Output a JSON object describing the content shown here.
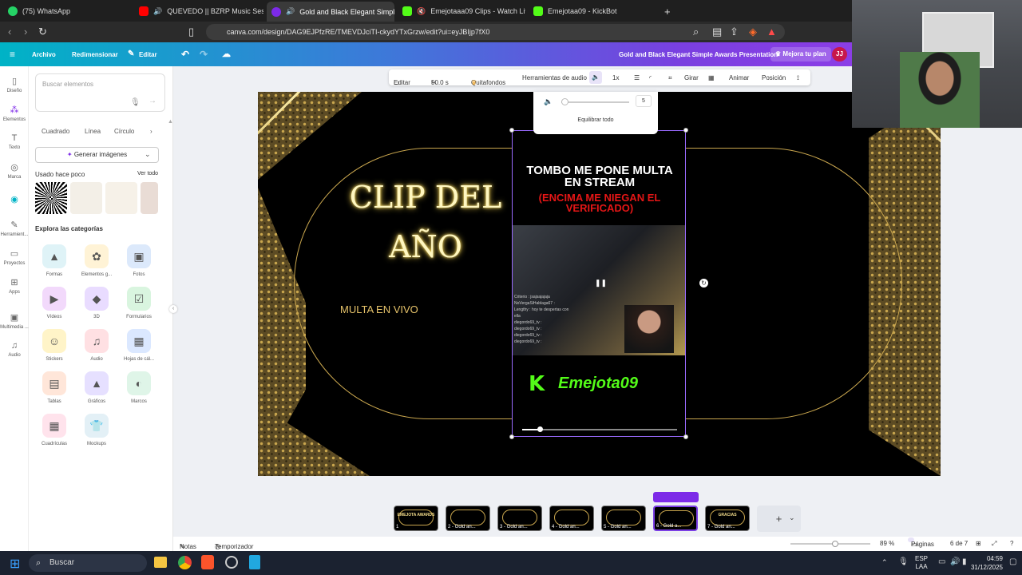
{
  "browser": {
    "tabs": [
      {
        "label": "(75) WhatsApp",
        "color": "#25d366"
      },
      {
        "label": "QUEVEDO || BZRP Music Session",
        "color": "#ff0000"
      },
      {
        "label": "Gold and Black Elegant Simpl",
        "color": "#7d2ae8"
      },
      {
        "label": "Emejotaaa09 Clips - Watch Live o",
        "color": "#53fc18"
      },
      {
        "label": "Emejotaa09 - KickBot",
        "color": "#53fc18"
      }
    ],
    "new_tab": "+",
    "url": "canva.com/design/DAG9EJPfzRE/TMEVDJciTI-ckydYTxGrzw/edit?ui=eyJBIjp7fX0"
  },
  "canva": {
    "menu": [
      "Archivo",
      "Redimensionar",
      "Editar"
    ],
    "doc_title": "Gold and Black Elegant Simple Awards Presentation",
    "upgrade": "Mejora tu plan",
    "avatar": "JJ"
  },
  "rail": [
    "Diseño",
    "Elementos",
    "Texto",
    "Marca",
    "Herramient...",
    "Proyectos",
    "Apps",
    "Multimedia ...",
    "Audio"
  ],
  "panel": {
    "search_placeholder": "Buscar elementos",
    "chips": [
      "Cuadrado",
      "Línea",
      "Círculo"
    ],
    "generate": "Generar imágenes",
    "recent_title": "Usado hace poco",
    "see_all": "Ver todo",
    "categories_title": "Explora las categorías",
    "categories": [
      {
        "label": "Formas",
        "icon": "shapes-icon",
        "bg": "#dff3f7",
        "glyph": "▲"
      },
      {
        "label": "Elementos g...",
        "icon": "sunflower-icon",
        "bg": "#fff3d6",
        "glyph": "✿"
      },
      {
        "label": "Fotos",
        "icon": "photo-icon",
        "bg": "#dce9fb",
        "glyph": "▣"
      },
      {
        "label": "Vídeos",
        "icon": "video-icon",
        "bg": "#f2d9fb",
        "glyph": "▶"
      },
      {
        "label": "3D",
        "icon": "cube-icon",
        "bg": "#e9dcff",
        "glyph": "◆"
      },
      {
        "label": "Formularios",
        "icon": "form-icon",
        "bg": "#d9f5df",
        "glyph": "☑"
      },
      {
        "label": "Stickers",
        "icon": "smiley-icon",
        "bg": "#fff4c8",
        "glyph": "☺"
      },
      {
        "label": "Audio",
        "icon": "music-icon",
        "bg": "#ffe0e3",
        "glyph": "♫"
      },
      {
        "label": "Hojas de cál...",
        "icon": "sheet-icon",
        "bg": "#dbe8ff",
        "glyph": "▦"
      },
      {
        "label": "Tablas",
        "icon": "table-icon",
        "bg": "#ffe6d9",
        "glyph": "▤"
      },
      {
        "label": "Gráficos",
        "icon": "chart-icon",
        "bg": "#e6e0ff",
        "glyph": "▲"
      },
      {
        "label": "Marcos",
        "icon": "frame-icon",
        "bg": "#dff5e8",
        "glyph": "◐"
      },
      {
        "label": "Cuadrículas",
        "icon": "grid-icon",
        "bg": "#ffe3ec",
        "glyph": "▦"
      },
      {
        "label": "Mockups",
        "icon": "shirt-icon",
        "bg": "#e3f0f6",
        "glyph": "👕"
      }
    ]
  },
  "toolbar": {
    "items": [
      "Editar",
      "50.0 s",
      "Quitafondos",
      "Herramientas de audio",
      "1x",
      "Girar",
      "Animar",
      "Posición"
    ]
  },
  "volume": {
    "value": "5",
    "balance": "Equilibrar todo"
  },
  "slide": {
    "title_line1": "CLIP DEL",
    "title_line2": "AÑO",
    "subtitle": "MULTA EN VIVO",
    "video_caption_white": "TOMBO ME PONE MULTA EN STREAM",
    "video_caption_red": "(ENCIMA ME NIEGAN EL VERIFICADO)",
    "channel": "Emejota09",
    "channel_logo": "K",
    "chat": [
      "Criterio : jsajsajajaja",
      "NoVergaSiHablaga67 :",
      "Lengthy : hoy te despertas con",
      "ella",
      "diegordo69_tv :",
      "diegordo69_tv :",
      "diegordo69_tv :",
      "diegordo69_tv :"
    ]
  },
  "pages": {
    "thumbs": [
      {
        "label": "1",
        "text": "EMEJOTA AWARDS"
      },
      {
        "label": "2 - Gold an...",
        "text": ""
      },
      {
        "label": "3 - Gold an...",
        "text": ""
      },
      {
        "label": "4 - Gold an...",
        "text": ""
      },
      {
        "label": "5 - Gold an...",
        "text": ""
      },
      {
        "label": "6 - Gold a...",
        "text": ""
      },
      {
        "label": "7 - Gold an...",
        "text": "GRACIAS"
      }
    ]
  },
  "footer": {
    "notes": "Notas",
    "timer": "Temporizador",
    "zoom": "89 %",
    "pages": "Páginas",
    "page_count": "6 de 7"
  },
  "taskbar": {
    "search": "Buscar",
    "lang": "ESP",
    "lang2": "LAA",
    "time": "04:59",
    "date": "31/12/2025"
  },
  "colors": {
    "accent": "#7d2ae8",
    "gold": "#c9a64e",
    "red_caption": "#e51616",
    "kick_green": "#53fc18"
  }
}
